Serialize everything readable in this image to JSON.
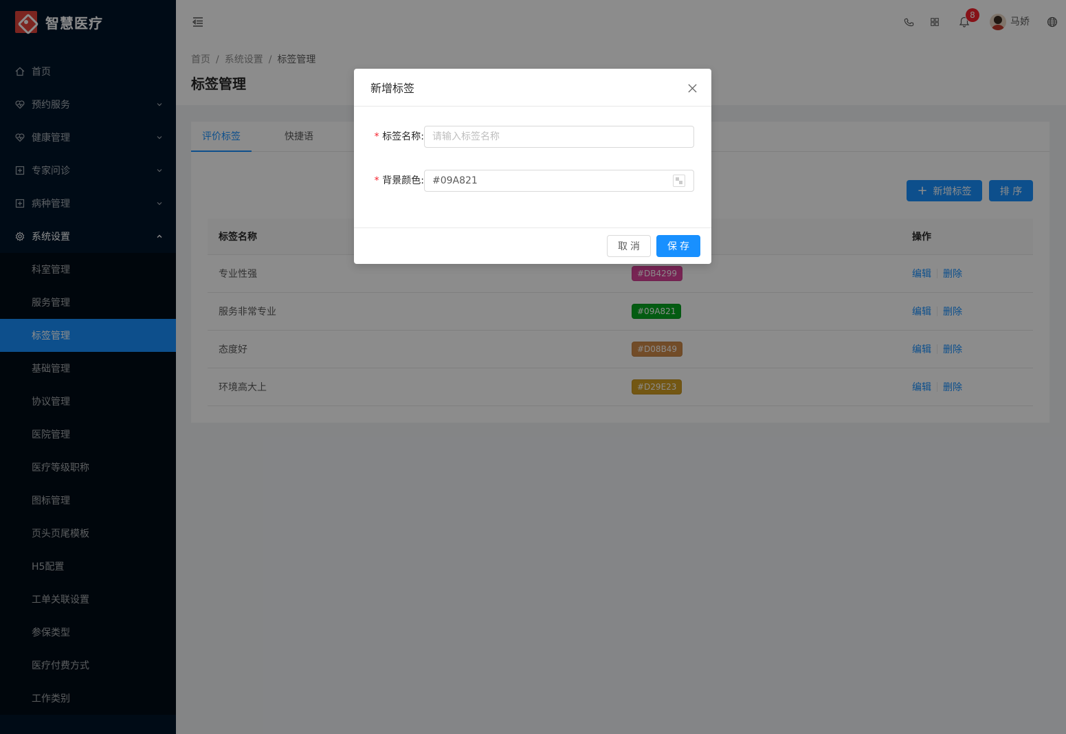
{
  "app": {
    "title": "智慧医疗"
  },
  "sidebar": {
    "items": [
      {
        "label": "首页",
        "icon": "home-icon"
      },
      {
        "label": "预约服务",
        "icon": "heart-icon"
      },
      {
        "label": "健康管理",
        "icon": "heart-icon"
      },
      {
        "label": "专家问诊",
        "icon": "medical-plus-icon"
      },
      {
        "label": "病种管理",
        "icon": "medical-plus-icon"
      },
      {
        "label": "系统设置",
        "icon": "gear-icon"
      }
    ],
    "submenu": [
      {
        "label": "科室管理"
      },
      {
        "label": "服务管理"
      },
      {
        "label": "标签管理",
        "active": true
      },
      {
        "label": "基础管理"
      },
      {
        "label": "协议管理"
      },
      {
        "label": "医院管理"
      },
      {
        "label": "医疗等级职称"
      },
      {
        "label": "图标管理"
      },
      {
        "label": "页头页尾模板"
      },
      {
        "label": "H5配置"
      },
      {
        "label": "工单关联设置"
      },
      {
        "label": "参保类型"
      },
      {
        "label": "医疗付费方式"
      },
      {
        "label": "工作类别"
      }
    ]
  },
  "header": {
    "notification_count": "8",
    "username": "马娇"
  },
  "breadcrumb": {
    "home": "首页",
    "section": "系统设置",
    "current": "标签管理"
  },
  "page": {
    "title": "标签管理"
  },
  "tabs": [
    {
      "label": "评价标签"
    },
    {
      "label": "快捷语"
    }
  ],
  "toolbar": {
    "add_label": "新增标签",
    "sort_label": "排 序"
  },
  "table": {
    "columns": {
      "name": "标签名称",
      "actions": "操作"
    },
    "rows": [
      {
        "name": "专业性强",
        "color": "#DB4299"
      },
      {
        "name": "服务非常专业",
        "color": "#09A821"
      },
      {
        "name": "态度好",
        "color": "#D08B49"
      },
      {
        "name": "环境高大上",
        "color": "#D29E23"
      }
    ],
    "edit_label": "编辑",
    "delete_label": "删除"
  },
  "modal": {
    "title": "新增标签",
    "name_label": "标签名称:",
    "name_placeholder": "请输入标签名称",
    "color_label": "背景颜色:",
    "color_value": "#09A821",
    "cancel_label": "取消",
    "save_label": "保存"
  },
  "colors": {
    "primary": "#1890ff",
    "sidebar": "#001529",
    "danger": "#f5222d"
  }
}
